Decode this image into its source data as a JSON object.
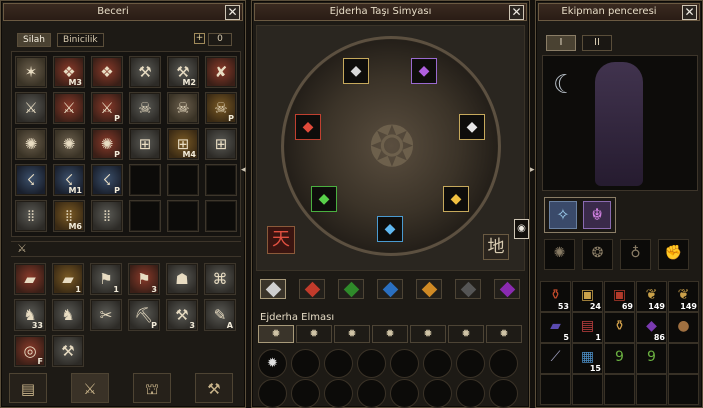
{
  "skill_window": {
    "title": "Beceri",
    "tabs": [
      "Silah",
      "Binicilik"
    ],
    "counter": "0",
    "plus": "+",
    "skills": [
      {
        "icon": "eagle-icon",
        "glyph": "✶",
        "lv": "",
        "tone": "skill"
      },
      {
        "icon": "dragon-icon",
        "glyph": "❖",
        "lv": "M3",
        "tone": "red"
      },
      {
        "icon": "dragon-icon",
        "glyph": "❖",
        "lv": "",
        "tone": "red"
      },
      {
        "icon": "axe-icon",
        "glyph": "⚒",
        "lv": "",
        "tone": "gray"
      },
      {
        "icon": "axe-icon",
        "glyph": "⚒",
        "lv": "M2",
        "tone": "gray"
      },
      {
        "icon": "claw-icon",
        "glyph": "✘",
        "lv": "",
        "tone": "red"
      },
      {
        "icon": "sword-icon",
        "glyph": "⚔",
        "lv": "",
        "tone": "gray"
      },
      {
        "icon": "sword-icon",
        "glyph": "⚔",
        "lv": "",
        "tone": "red"
      },
      {
        "icon": "sword-strike-icon",
        "glyph": "⚔",
        "lv": "P",
        "tone": "red"
      },
      {
        "icon": "skull-icon",
        "glyph": "☠",
        "lv": "",
        "tone": "gray"
      },
      {
        "icon": "skull-icon",
        "glyph": "☠",
        "lv": "",
        "tone": "skill"
      },
      {
        "icon": "skull-icon",
        "glyph": "☠",
        "lv": "P",
        "tone": "gold"
      },
      {
        "icon": "bee-icon",
        "glyph": "✺",
        "lv": "",
        "tone": "skill"
      },
      {
        "icon": "bee-icon",
        "glyph": "✺",
        "lv": "",
        "tone": "skill"
      },
      {
        "icon": "bee-icon",
        "glyph": "✺",
        "lv": "P",
        "tone": "red"
      },
      {
        "icon": "seal-icon",
        "glyph": "⊞",
        "lv": "",
        "tone": "gray"
      },
      {
        "icon": "seal-icon",
        "glyph": "⊞",
        "lv": "M4",
        "tone": "gold"
      },
      {
        "icon": "seal-icon",
        "glyph": "⊞",
        "lv": "",
        "tone": "gray"
      },
      {
        "icon": "runner-icon",
        "glyph": "☇",
        "lv": "",
        "tone": "dark"
      },
      {
        "icon": "runner-icon",
        "glyph": "☇",
        "lv": "M1",
        "tone": "dark"
      },
      {
        "icon": "runner-icon",
        "glyph": "☇",
        "lv": "P",
        "tone": "dark"
      },
      {
        "icon": "",
        "glyph": "",
        "lv": "",
        "tone": ""
      },
      {
        "icon": "",
        "glyph": "",
        "lv": "",
        "tone": ""
      },
      {
        "icon": "",
        "glyph": "",
        "lv": "",
        "tone": ""
      },
      {
        "icon": "chain-icon",
        "glyph": "⦙⦙",
        "lv": "",
        "tone": "gray"
      },
      {
        "icon": "chain-icon",
        "glyph": "⦙⦙",
        "lv": "M6",
        "tone": "gold"
      },
      {
        "icon": "chain-icon",
        "glyph": "⦙⦙",
        "lv": "",
        "tone": "gray"
      },
      {
        "icon": "",
        "glyph": "",
        "lv": "",
        "tone": ""
      },
      {
        "icon": "",
        "glyph": "",
        "lv": "",
        "tone": ""
      },
      {
        "icon": "",
        "glyph": "",
        "lv": "",
        "tone": ""
      }
    ],
    "support": [
      {
        "icon": "book-red-icon",
        "glyph": "▰",
        "lv": "",
        "tone": "red"
      },
      {
        "icon": "book-gold-icon",
        "glyph": "▰",
        "lv": "1",
        "tone": "gold"
      },
      {
        "icon": "flag-icon",
        "glyph": "⚑",
        "lv": "1",
        "tone": "gray"
      },
      {
        "icon": "flag-up-icon",
        "glyph": "⚑",
        "lv": "3",
        "tone": "red"
      },
      {
        "icon": "group-icon",
        "glyph": "☗",
        "lv": "",
        "tone": "gray"
      },
      {
        "icon": "knot-icon",
        "glyph": "⌘",
        "lv": "",
        "tone": "gray"
      },
      {
        "icon": "horse-icon",
        "glyph": "♞",
        "lv": "33",
        "tone": "gray"
      },
      {
        "icon": "horse-icon",
        "glyph": "♞",
        "lv": "",
        "tone": "gray"
      },
      {
        "icon": "scissors-icon",
        "glyph": "✂",
        "lv": "",
        "tone": "gray"
      },
      {
        "icon": "pickaxe-icon",
        "glyph": "⛏",
        "lv": "P",
        "tone": "gray"
      },
      {
        "icon": "tools-icon",
        "glyph": "⚒",
        "lv": "3",
        "tone": "gray"
      },
      {
        "icon": "pen-icon",
        "glyph": "✎",
        "lv": "A",
        "tone": "gray"
      },
      {
        "icon": "target-icon",
        "glyph": "◎",
        "lv": "F",
        "tone": "red"
      },
      {
        "icon": "hammer-icon",
        "glyph": "⚒",
        "lv": "",
        "tone": "gray"
      }
    ]
  },
  "alchemy_window": {
    "title": "Ejderha Taşı Simyası",
    "left_char": "天",
    "right_char": "地",
    "elma_label": "Ejderha Elması",
    "colors": [
      "#cfcfcf",
      "#c23b2b",
      "#2f8a2a",
      "#2a6fc0",
      "#d08a25",
      "#555555",
      "#8a2ab0"
    ]
  },
  "equipment_window": {
    "title": "Ekipman penceresi",
    "page_tabs": [
      "I",
      "II"
    ],
    "inventory": [
      {
        "icon": "potion-icon",
        "glyph": "⚱",
        "lv": "53",
        "color": "#c24a2a"
      },
      {
        "icon": "chest-icon",
        "glyph": "▣",
        "lv": "24",
        "color": "#caa24a"
      },
      {
        "icon": "chest-icon",
        "glyph": "▣",
        "lv": "69",
        "color": "#b23a2a"
      },
      {
        "icon": "horn-icon",
        "glyph": "❦",
        "lv": "149",
        "color": "#caa24a"
      },
      {
        "icon": "leaf-icon",
        "glyph": "❦",
        "lv": "149",
        "color": "#cba04a"
      },
      {
        "icon": "book-icon",
        "glyph": "▰",
        "lv": "5",
        "color": "#5a4ab0"
      },
      {
        "icon": "scroll-icon",
        "glyph": "▤",
        "lv": "1",
        "color": "#c04040"
      },
      {
        "icon": "horn-icon",
        "glyph": "⚱",
        "lv": "",
        "color": "#d2a04a"
      },
      {
        "icon": "gem-icon",
        "glyph": "◆",
        "lv": "86",
        "color": "#7a3ab0"
      },
      {
        "icon": "pouch-icon",
        "glyph": "●",
        "lv": "",
        "color": "#a07040"
      },
      {
        "icon": "wand-icon",
        "glyph": "⟋",
        "lv": "",
        "color": "#a0a0c0"
      },
      {
        "icon": "card-icon",
        "glyph": "▦",
        "lv": "15",
        "color": "#4a8ac0"
      },
      {
        "icon": "voucher-icon",
        "glyph": "9",
        "lv": "",
        "color": "#6ab040"
      },
      {
        "icon": "voucher-icon",
        "glyph": "9",
        "lv": "",
        "color": "#6ab040"
      }
    ]
  }
}
